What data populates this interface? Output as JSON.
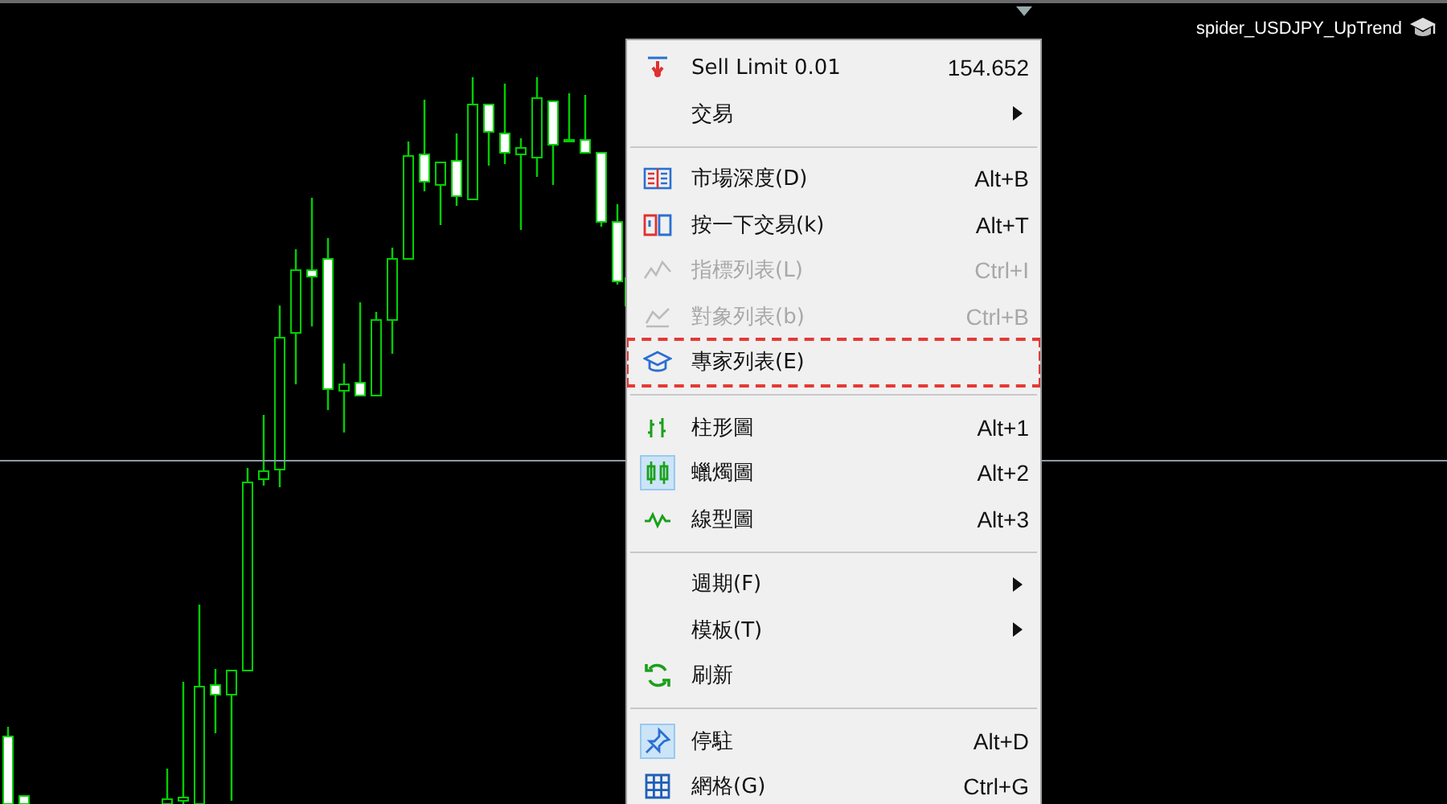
{
  "chart": {
    "label": "spider_USDJPY_UpTrend"
  },
  "menu": {
    "sections": [
      {
        "items": [
          {
            "label": "Sell Limit 0.01",
            "shortcut": "154.652",
            "submenu": false,
            "disabled": false,
            "checked": false,
            "annotated": false
          },
          {
            "label": "交易",
            "submenu": true,
            "disabled": false,
            "checked": false,
            "annotated": false
          }
        ]
      },
      {
        "items": [
          {
            "label": "市場深度(D)",
            "shortcut": "Alt+B",
            "submenu": false,
            "disabled": false,
            "checked": false,
            "annotated": false
          },
          {
            "label": "按一下交易(k)",
            "shortcut": "Alt+T",
            "submenu": false,
            "disabled": false,
            "checked": false,
            "annotated": false
          },
          {
            "label": "指標列表(L)",
            "shortcut": "Ctrl+I",
            "submenu": false,
            "disabled": true,
            "checked": false,
            "annotated": false
          },
          {
            "label": "對象列表(b)",
            "shortcut": "Ctrl+B",
            "submenu": false,
            "disabled": true,
            "checked": false,
            "annotated": false
          },
          {
            "label": "專家列表(E)",
            "submenu": false,
            "disabled": false,
            "checked": false,
            "annotated": true
          }
        ]
      },
      {
        "items": [
          {
            "label": "柱形圖",
            "shortcut": "Alt+1",
            "submenu": false,
            "disabled": false,
            "checked": false,
            "annotated": false
          },
          {
            "label": "蠟燭圖",
            "shortcut": "Alt+2",
            "submenu": false,
            "disabled": false,
            "checked": true,
            "annotated": false
          },
          {
            "label": "線型圖",
            "shortcut": "Alt+3",
            "submenu": false,
            "disabled": false,
            "checked": false,
            "annotated": false
          }
        ]
      },
      {
        "items": [
          {
            "label": "週期(F)",
            "submenu": true,
            "disabled": false,
            "checked": false,
            "annotated": false
          },
          {
            "label": "模板(T)",
            "submenu": true,
            "disabled": false,
            "checked": false,
            "annotated": false
          },
          {
            "label": "刷新",
            "submenu": false,
            "disabled": false,
            "checked": false,
            "annotated": false
          }
        ]
      },
      {
        "items": [
          {
            "label": "停駐",
            "shortcut": "Alt+D",
            "submenu": false,
            "disabled": false,
            "checked": true,
            "annotated": false
          },
          {
            "label": "網格(G)",
            "shortcut": "Ctrl+G",
            "submenu": false,
            "disabled": false,
            "checked": false,
            "annotated": false
          }
        ]
      }
    ]
  }
}
